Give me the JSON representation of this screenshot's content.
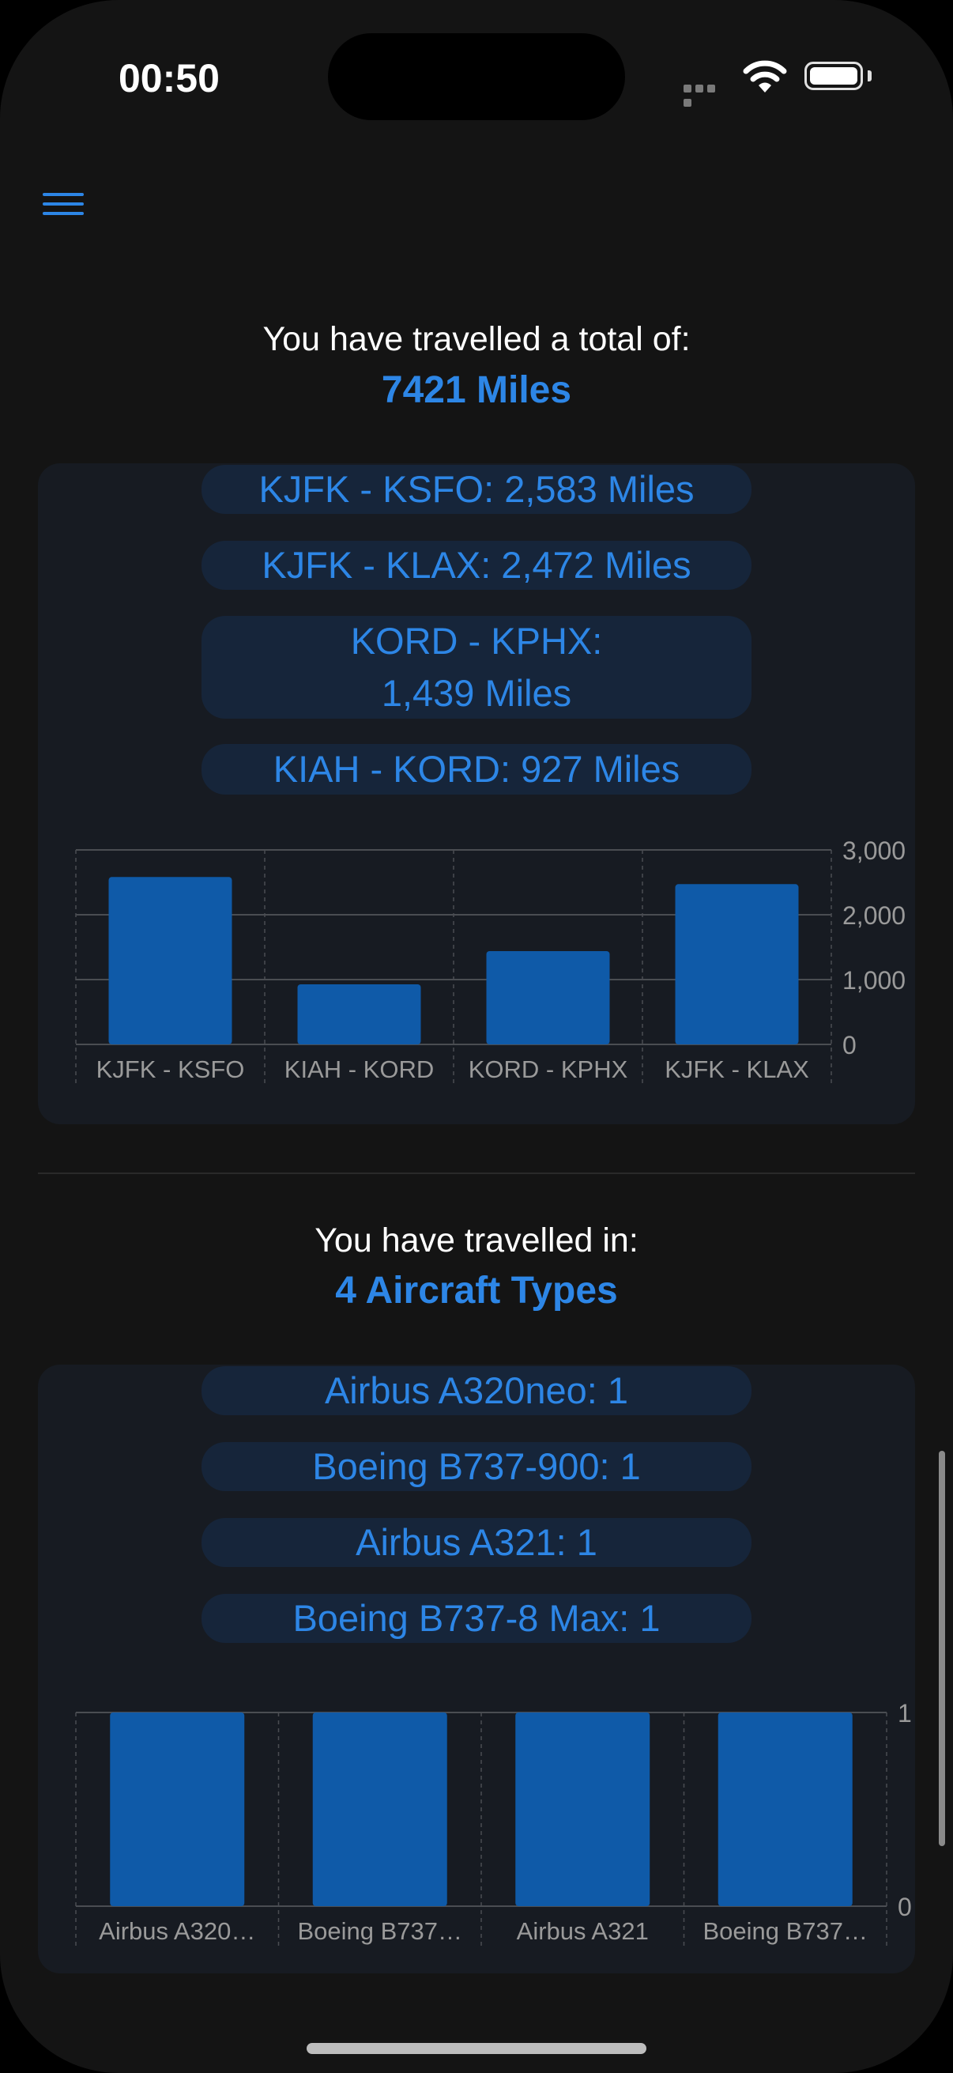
{
  "status_bar": {
    "time": "00:50"
  },
  "distance": {
    "heading": "You have travelled a total of:",
    "total": "7421 Miles",
    "routes": [
      "KJFK - KSFO: 2,583 Miles",
      "KJFK - KLAX: 2,472 Miles",
      "KORD - KPHX: 1,439 Miles",
      "KIAH - KORD: 927 Miles"
    ]
  },
  "aircraft": {
    "heading": "You have travelled in:",
    "total": "4 Aircraft Types",
    "types": [
      "Airbus A320neo: 1",
      "Boeing B737-900: 1",
      "Airbus A321: 1",
      "Boeing B737-8 Max: 1"
    ]
  },
  "chart_data": [
    {
      "type": "bar",
      "categories": [
        "KJFK - KSFO",
        "KIAH - KORD",
        "KORD - KPHX",
        "KJFK - KLAX"
      ],
      "values": [
        2583,
        927,
        1439,
        2472
      ],
      "yticks": [
        "0",
        "1,000",
        "2,000",
        "3,000"
      ],
      "ylim": [
        0,
        3000
      ],
      "grid": true,
      "bar_color": "#0f5aa8"
    },
    {
      "type": "bar",
      "categories": [
        "Airbus A320…",
        "Boeing B737…",
        "Airbus A321",
        "Boeing B737…"
      ],
      "values": [
        1,
        1,
        1,
        1
      ],
      "yticks": [
        "0",
        "1"
      ],
      "ylim": [
        0,
        1
      ],
      "grid": true,
      "bar_color": "#0f5aa8"
    }
  ],
  "colors": {
    "accent": "#2d86e6",
    "background": "#141414",
    "card": "#171b22",
    "pill": "#16253a"
  }
}
